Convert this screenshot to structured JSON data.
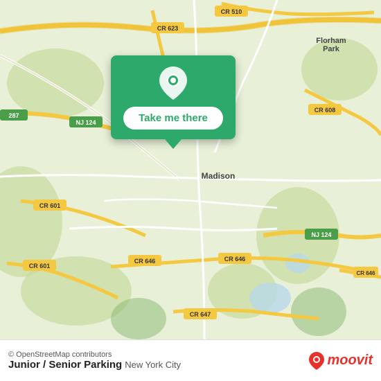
{
  "map": {
    "attribution": "© OpenStreetMap contributors",
    "background_color": "#e8f0d8"
  },
  "popup": {
    "button_label": "Take me there",
    "icon": "location-pin"
  },
  "bottom_bar": {
    "location_name": "Junior / Senior Parking",
    "location_city": "New York City",
    "logo_text": "moovit",
    "attribution": "© OpenStreetMap contributors"
  }
}
